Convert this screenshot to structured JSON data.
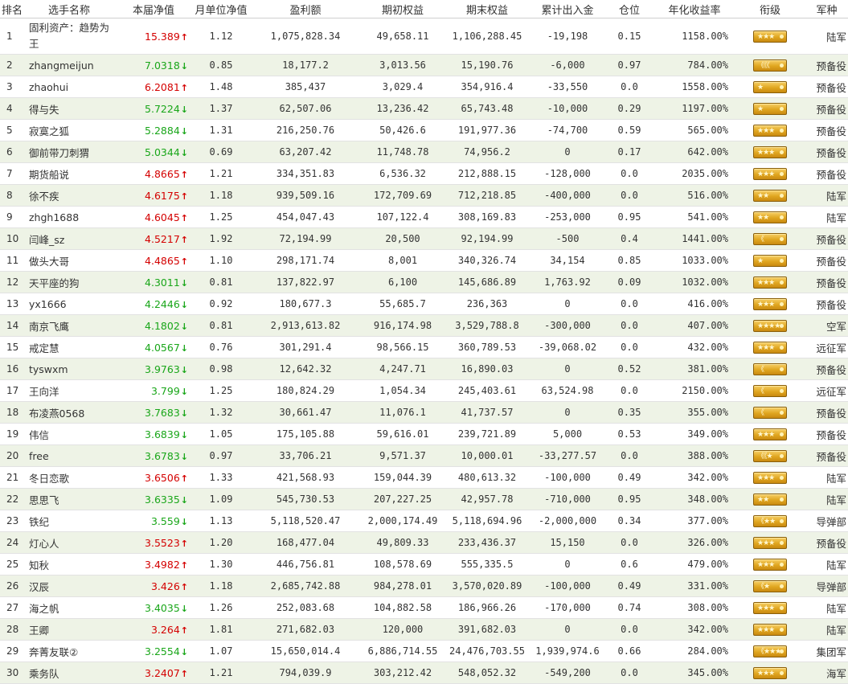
{
  "headers": [
    "排名",
    "选手名称",
    "本届净值",
    "月单位净值",
    "盈利额",
    "期初权益",
    "期末权益",
    "累计出入金",
    "仓位",
    "年化收益率",
    "衔级",
    "军种"
  ],
  "colors": {
    "up": "#d40000",
    "down": "#19a619",
    "row_alt": "#eef3e6"
  },
  "rows": [
    {
      "rank": "1",
      "name": "固利资产：趋势为王",
      "nav": "15.389",
      "dir": "up",
      "unit": "1.12",
      "profit": "1,075,828.34",
      "begin": "49,658.11",
      "end": "1,106,288.45",
      "flow": "-19,198",
      "pos": "0.15",
      "annual": "1158.00%",
      "rank_mark": "★★★",
      "branch": "陆军"
    },
    {
      "rank": "2",
      "name": "zhangmeijun",
      "nav": "7.0318",
      "dir": "down",
      "unit": "0.85",
      "profit": "18,177.2",
      "begin": "3,013.56",
      "end": "15,190.76",
      "flow": "-6,000",
      "pos": "0.97",
      "annual": "784.00%",
      "rank_mark": "《《《",
      "branch": "预备役"
    },
    {
      "rank": "3",
      "name": "zhaohui",
      "nav": "6.2081",
      "dir": "up",
      "unit": "1.48",
      "profit": "385,437",
      "begin": "3,029.4",
      "end": "354,916.4",
      "flow": "-33,550",
      "pos": "0.0",
      "annual": "1558.00%",
      "rank_mark": "★",
      "branch": "预备役"
    },
    {
      "rank": "4",
      "name": "得与失",
      "nav": "5.7224",
      "dir": "down",
      "unit": "1.37",
      "profit": "62,507.06",
      "begin": "13,236.42",
      "end": "65,743.48",
      "flow": "-10,000",
      "pos": "0.29",
      "annual": "1197.00%",
      "rank_mark": "★",
      "branch": "预备役"
    },
    {
      "rank": "5",
      "name": "寂寞之狐",
      "nav": "5.2884",
      "dir": "down",
      "unit": "1.31",
      "profit": "216,250.76",
      "begin": "50,426.6",
      "end": "191,977.36",
      "flow": "-74,700",
      "pos": "0.59",
      "annual": "565.00%",
      "rank_mark": "★★★",
      "branch": "预备役"
    },
    {
      "rank": "6",
      "name": "御前带刀刺猬",
      "nav": "5.0344",
      "dir": "down",
      "unit": "0.69",
      "profit": "63,207.42",
      "begin": "11,748.78",
      "end": "74,956.2",
      "flow": "0",
      "pos": "0.17",
      "annual": "642.00%",
      "rank_mark": "★★★",
      "branch": "预备役"
    },
    {
      "rank": "7",
      "name": "期货船说",
      "nav": "4.8665",
      "dir": "up",
      "unit": "1.21",
      "profit": "334,351.83",
      "begin": "6,536.32",
      "end": "212,888.15",
      "flow": "-128,000",
      "pos": "0.0",
      "annual": "2035.00%",
      "rank_mark": "★★★",
      "branch": "预备役"
    },
    {
      "rank": "8",
      "name": "徐不疾",
      "nav": "4.6175",
      "dir": "up",
      "unit": "1.18",
      "profit": "939,509.16",
      "begin": "172,709.69",
      "end": "712,218.85",
      "flow": "-400,000",
      "pos": "0.0",
      "annual": "516.00%",
      "rank_mark": "★★",
      "branch": "陆军"
    },
    {
      "rank": "9",
      "name": "zhgh1688",
      "nav": "4.6045",
      "dir": "up",
      "unit": "1.25",
      "profit": "454,047.43",
      "begin": "107,122.4",
      "end": "308,169.83",
      "flow": "-253,000",
      "pos": "0.95",
      "annual": "541.00%",
      "rank_mark": "★★",
      "branch": "陆军"
    },
    {
      "rank": "10",
      "name": "闫峰_sz",
      "nav": "4.5217",
      "dir": "up",
      "unit": "1.92",
      "profit": "72,194.99",
      "begin": "20,500",
      "end": "92,194.99",
      "flow": "-500",
      "pos": "0.4",
      "annual": "1441.00%",
      "rank_mark": "《",
      "branch": "预备役"
    },
    {
      "rank": "11",
      "name": "做头大哥",
      "nav": "4.4865",
      "dir": "up",
      "unit": "1.10",
      "profit": "298,171.74",
      "begin": "8,001",
      "end": "340,326.74",
      "flow": "34,154",
      "pos": "0.85",
      "annual": "1033.00%",
      "rank_mark": "★",
      "branch": "预备役"
    },
    {
      "rank": "12",
      "name": "天平座的狗",
      "nav": "4.3011",
      "dir": "down",
      "unit": "0.81",
      "profit": "137,822.97",
      "begin": "6,100",
      "end": "145,686.89",
      "flow": "1,763.92",
      "pos": "0.09",
      "annual": "1032.00%",
      "rank_mark": "★★★",
      "branch": "预备役"
    },
    {
      "rank": "13",
      "name": "yx1666",
      "nav": "4.2446",
      "dir": "down",
      "unit": "0.92",
      "profit": "180,677.3",
      "begin": "55,685.7",
      "end": "236,363",
      "flow": "0",
      "pos": "0.0",
      "annual": "416.00%",
      "rank_mark": "★★★",
      "branch": "预备役"
    },
    {
      "rank": "14",
      "name": "南京飞鹰",
      "nav": "4.1802",
      "dir": "down",
      "unit": "0.81",
      "profit": "2,913,613.82",
      "begin": "916,174.98",
      "end": "3,529,788.8",
      "flow": "-300,000",
      "pos": "0.0",
      "annual": "407.00%",
      "rank_mark": "★★★★",
      "branch": "空军"
    },
    {
      "rank": "15",
      "name": "戒定慧",
      "nav": "4.0567",
      "dir": "down",
      "unit": "0.76",
      "profit": "301,291.4",
      "begin": "98,566.15",
      "end": "360,789.53",
      "flow": "-39,068.02",
      "pos": "0.0",
      "annual": "432.00%",
      "rank_mark": "★★★",
      "branch": "远征军"
    },
    {
      "rank": "16",
      "name": "tyswxm",
      "nav": "3.9763",
      "dir": "down",
      "unit": "0.98",
      "profit": "12,642.32",
      "begin": "4,247.71",
      "end": "16,890.03",
      "flow": "0",
      "pos": "0.52",
      "annual": "381.00%",
      "rank_mark": "《",
      "branch": "预备役"
    },
    {
      "rank": "17",
      "name": "王向洋",
      "nav": "3.799",
      "dir": "down",
      "unit": "1.25",
      "profit": "180,824.29",
      "begin": "1,054.34",
      "end": "245,403.61",
      "flow": "63,524.98",
      "pos": "0.0",
      "annual": "2150.00%",
      "rank_mark": "《",
      "branch": "远征军"
    },
    {
      "rank": "18",
      "name": "布凌燕0568",
      "nav": "3.7683",
      "dir": "down",
      "unit": "1.32",
      "profit": "30,661.47",
      "begin": "11,076.1",
      "end": "41,737.57",
      "flow": "0",
      "pos": "0.35",
      "annual": "355.00%",
      "rank_mark": "《",
      "branch": "预备役"
    },
    {
      "rank": "19",
      "name": "伟信",
      "nav": "3.6839",
      "dir": "down",
      "unit": "1.05",
      "profit": "175,105.88",
      "begin": "59,616.01",
      "end": "239,721.89",
      "flow": "5,000",
      "pos": "0.53",
      "annual": "349.00%",
      "rank_mark": "★★★",
      "branch": "预备役"
    },
    {
      "rank": "20",
      "name": "free",
      "nav": "3.6783",
      "dir": "down",
      "unit": "0.97",
      "profit": "33,706.21",
      "begin": "9,571.37",
      "end": "10,000.01",
      "flow": "-33,277.57",
      "pos": "0.0",
      "annual": "388.00%",
      "rank_mark": "《《★",
      "branch": "预备役"
    },
    {
      "rank": "21",
      "name": "冬日恋歌",
      "nav": "3.6506",
      "dir": "up",
      "unit": "1.33",
      "profit": "421,568.93",
      "begin": "159,044.39",
      "end": "480,613.32",
      "flow": "-100,000",
      "pos": "0.49",
      "annual": "342.00%",
      "rank_mark": "★★★",
      "branch": "陆军"
    },
    {
      "rank": "22",
      "name": "思思飞",
      "nav": "3.6335",
      "dir": "down",
      "unit": "1.09",
      "profit": "545,730.53",
      "begin": "207,227.25",
      "end": "42,957.78",
      "flow": "-710,000",
      "pos": "0.95",
      "annual": "348.00%",
      "rank_mark": "★★",
      "branch": "陆军"
    },
    {
      "rank": "23",
      "name": "铁纪",
      "nav": "3.559",
      "dir": "down",
      "unit": "1.13",
      "profit": "5,118,520.47",
      "begin": "2,000,174.49",
      "end": "5,118,694.96",
      "flow": "-2,000,000",
      "pos": "0.34",
      "annual": "377.00%",
      "rank_mark": "《★★",
      "branch": "导弹部"
    },
    {
      "rank": "24",
      "name": "灯心人",
      "nav": "3.5523",
      "dir": "up",
      "unit": "1.20",
      "profit": "168,477.04",
      "begin": "49,809.33",
      "end": "233,436.37",
      "flow": "15,150",
      "pos": "0.0",
      "annual": "326.00%",
      "rank_mark": "★★★",
      "branch": "预备役"
    },
    {
      "rank": "25",
      "name": "知秋",
      "nav": "3.4982",
      "dir": "up",
      "unit": "1.30",
      "profit": "446,756.81",
      "begin": "108,578.69",
      "end": "555,335.5",
      "flow": "0",
      "pos": "0.6",
      "annual": "479.00%",
      "rank_mark": "★★★",
      "branch": "陆军"
    },
    {
      "rank": "26",
      "name": "汉辰",
      "nav": "3.426",
      "dir": "up",
      "unit": "1.18",
      "profit": "2,685,742.88",
      "begin": "984,278.01",
      "end": "3,570,020.89",
      "flow": "-100,000",
      "pos": "0.49",
      "annual": "331.00%",
      "rank_mark": "《★",
      "branch": "导弹部"
    },
    {
      "rank": "27",
      "name": "海之帆",
      "nav": "3.4035",
      "dir": "down",
      "unit": "1.26",
      "profit": "252,083.68",
      "begin": "104,882.58",
      "end": "186,966.26",
      "flow": "-170,000",
      "pos": "0.74",
      "annual": "308.00%",
      "rank_mark": "★★★",
      "branch": "陆军"
    },
    {
      "rank": "28",
      "name": "王卿",
      "nav": "3.264",
      "dir": "up",
      "unit": "1.81",
      "profit": "271,682.03",
      "begin": "120,000",
      "end": "391,682.03",
      "flow": "0",
      "pos": "0.0",
      "annual": "342.00%",
      "rank_mark": "★★★",
      "branch": "陆军"
    },
    {
      "rank": "29",
      "name": "奔菁友联②",
      "nav": "3.2554",
      "dir": "down",
      "unit": "1.07",
      "profit": "15,650,014.4",
      "begin": "6,886,714.55",
      "end": "24,476,703.55",
      "flow": "1,939,974.6",
      "pos": "0.66",
      "annual": "284.00%",
      "rank_mark": "《★★★",
      "branch": "集团军"
    },
    {
      "rank": "30",
      "name": "乘务队",
      "nav": "3.2407",
      "dir": "up",
      "unit": "1.21",
      "profit": "794,039.9",
      "begin": "303,212.42",
      "end": "548,052.32",
      "flow": "-549,200",
      "pos": "0.0",
      "annual": "345.00%",
      "rank_mark": "★★★",
      "branch": "海军"
    }
  ]
}
